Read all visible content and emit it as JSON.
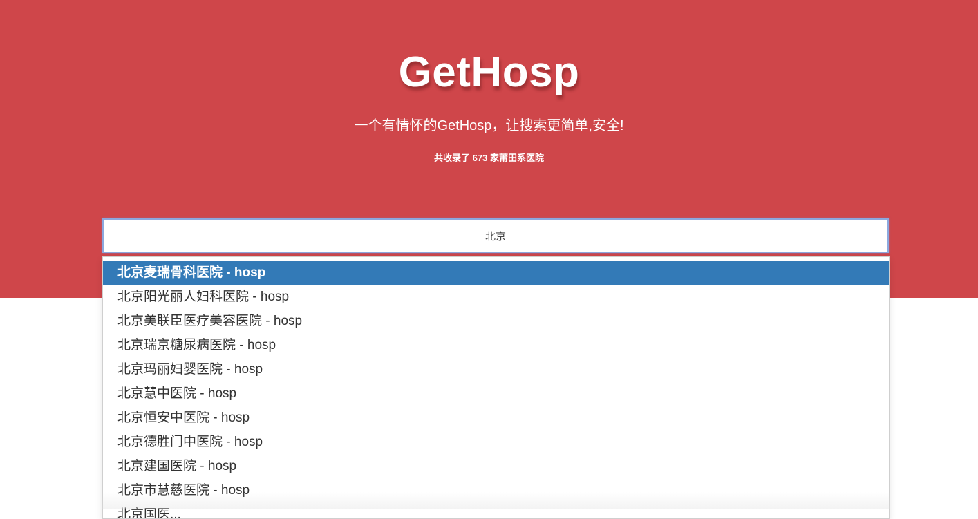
{
  "header": {
    "title": "GetHosp",
    "subtitle": "一个有情怀的GetHosp，让搜索更简单,安全!",
    "count_prefix": "共收录了",
    "count_value": "673",
    "count_suffix": "家莆田系医院"
  },
  "search": {
    "value": "北京",
    "placeholder": ""
  },
  "suggestions": [
    "北京麦瑞骨科医院 - hosp",
    "北京阳光丽人妇科医院 - hosp",
    "北京美联臣医疗美容医院 - hosp",
    "北京瑞京糖尿病医院 - hosp",
    "北京玛丽妇婴医院 - hosp",
    "北京慧中医院 - hosp",
    "北京恒安中医院 - hosp",
    "北京德胜门中医院 - hosp",
    "北京建国医院 - hosp",
    "北京市慧慈医院 - hosp",
    "北京国医..."
  ],
  "colors": {
    "hero_bg": "#cf464a",
    "active_item_bg": "#337ab7"
  }
}
